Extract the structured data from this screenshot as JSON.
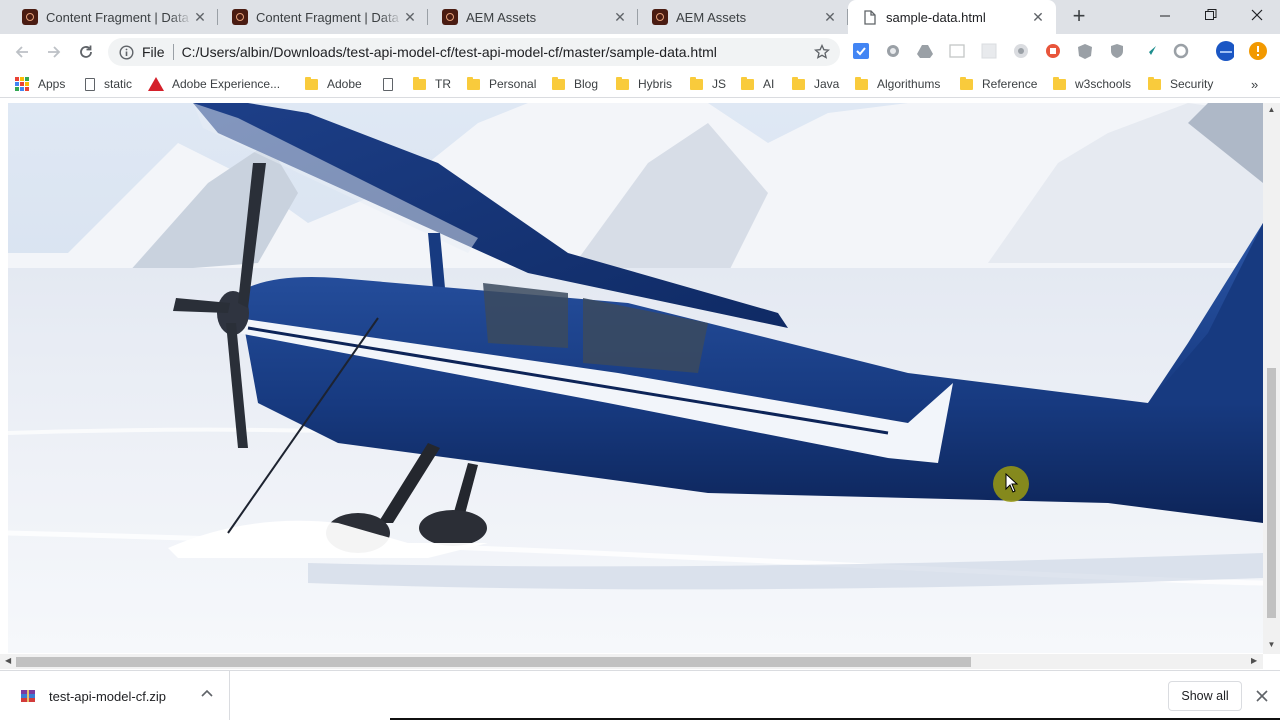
{
  "tabs": [
    {
      "title": "Content Fragment | Data M",
      "icon": "aem-icon",
      "active": false
    },
    {
      "title": "Content Fragment | Data M",
      "icon": "aem-icon",
      "active": false
    },
    {
      "title": "AEM Assets",
      "icon": "aem-icon",
      "active": false
    },
    {
      "title": "AEM Assets",
      "icon": "aem-icon",
      "active": false
    },
    {
      "title": "sample-data.html",
      "icon": "document-icon",
      "active": true
    }
  ],
  "toolbar": {
    "scheme": "File",
    "url": "C:/Users/albin/Downloads/test-api-model-cf/test-api-model-cf/master/sample-data.html"
  },
  "bookmarks": [
    {
      "label": "Apps",
      "icon": "apps-icon"
    },
    {
      "label": "static",
      "icon": "page-icon"
    },
    {
      "label": "Adobe Experience...",
      "icon": "adobe-icon"
    },
    {
      "label": "Adobe",
      "icon": "folder-icon"
    },
    {
      "label": "",
      "icon": "page-icon"
    },
    {
      "label": "TR",
      "icon": "folder-icon"
    },
    {
      "label": "Personal",
      "icon": "folder-icon"
    },
    {
      "label": "Blog",
      "icon": "folder-icon"
    },
    {
      "label": "Hybris",
      "icon": "folder-icon"
    },
    {
      "label": "JS",
      "icon": "folder-icon"
    },
    {
      "label": "AI",
      "icon": "folder-icon"
    },
    {
      "label": "Java",
      "icon": "folder-icon"
    },
    {
      "label": "Algorithums",
      "icon": "folder-icon"
    },
    {
      "label": "Reference",
      "icon": "folder-icon"
    },
    {
      "label": "w3schools",
      "icon": "folder-icon"
    },
    {
      "label": "Security",
      "icon": "folder-icon"
    }
  ],
  "page": {
    "image": "photo of a blue and white propeller airplane on skis parked on a snowy glacier with snow-covered mountains behind"
  },
  "downloads": {
    "filename": "test-api-model-cf.zip",
    "show_all_label": "Show all"
  },
  "colors": {
    "tab_strip": "#dee1e6",
    "omnibox": "#f1f3f4",
    "folder": "#f9cb3c",
    "plane_blue": "#1b3d82",
    "cursor_highlight": "#9a9a10"
  }
}
